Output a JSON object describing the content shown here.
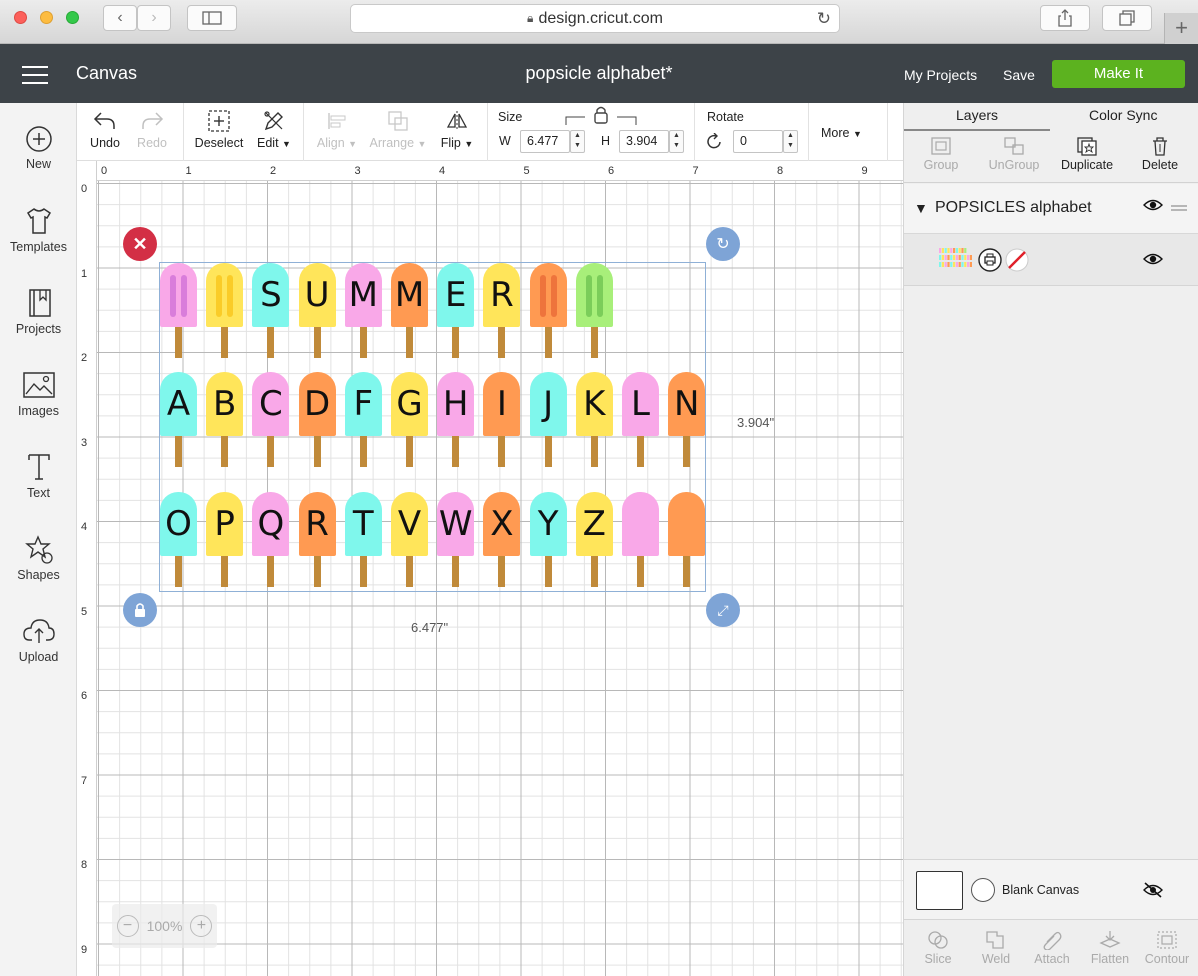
{
  "browser": {
    "url": "design.cricut.com"
  },
  "header": {
    "canvas_label": "Canvas",
    "doc_title": "popsicle alphabet*",
    "my_projects": "My Projects",
    "save": "Save",
    "make_it": "Make It",
    "accent_color": "#5cb21f"
  },
  "leftbar": {
    "items": [
      {
        "label": "New",
        "icon": "plus-circle-icon"
      },
      {
        "label": "Templates",
        "icon": "tshirt-icon"
      },
      {
        "label": "Projects",
        "icon": "book-icon"
      },
      {
        "label": "Images",
        "icon": "image-icon"
      },
      {
        "label": "Text",
        "icon": "text-icon"
      },
      {
        "label": "Shapes",
        "icon": "shapes-icon"
      },
      {
        "label": "Upload",
        "icon": "cloud-upload-icon"
      }
    ]
  },
  "toolbar": {
    "undo": "Undo",
    "redo": "Redo",
    "deselect": "Deselect",
    "edit": "Edit",
    "align": "Align",
    "arrange": "Arrange",
    "flip": "Flip",
    "size_label": "Size",
    "w_label": "W",
    "w_value": "6.477",
    "h_label": "H",
    "h_value": "3.904",
    "rotate_label": "Rotate",
    "rotate_value": "0",
    "more": "More"
  },
  "canvas": {
    "ruler_x": [
      "0",
      "1",
      "2",
      "3",
      "4",
      "5",
      "6",
      "7",
      "8",
      "9"
    ],
    "ruler_y": [
      "0",
      "1",
      "2",
      "3",
      "4",
      "5",
      "6",
      "7",
      "8",
      "9"
    ],
    "width_label": "6.477\"",
    "height_label": "3.904\"",
    "zoom": "100%",
    "popsicles": [
      [
        {
          "letter": "",
          "color": "#f9a8e8",
          "stripe": "#c05ad0"
        },
        {
          "letter": "",
          "color": "#ffe55a",
          "stripe": "#f5b800"
        },
        {
          "letter": "S",
          "color": "#7ff7ec"
        },
        {
          "letter": "U",
          "color": "#ffe55a"
        },
        {
          "letter": "M",
          "color": "#f9a8e8"
        },
        {
          "letter": "M",
          "color": "#ff9a52"
        },
        {
          "letter": "E",
          "color": "#7ff7ec"
        },
        {
          "letter": "R",
          "color": "#ffe55a"
        },
        {
          "letter": "",
          "color": "#ff9a52",
          "stripe": "#e0552a"
        },
        {
          "letter": "",
          "color": "#a8ef7a",
          "stripe": "#55b040"
        }
      ],
      [
        {
          "letter": "A",
          "color": "#7ff7ec"
        },
        {
          "letter": "B",
          "color": "#ffe55a"
        },
        {
          "letter": "C",
          "color": "#f9a8e8"
        },
        {
          "letter": "D",
          "color": "#ff9a52"
        },
        {
          "letter": "F",
          "color": "#7ff7ec"
        },
        {
          "letter": "G",
          "color": "#ffe55a"
        },
        {
          "letter": "H",
          "color": "#f9a8e8"
        },
        {
          "letter": "I",
          "color": "#ff9a52"
        },
        {
          "letter": "J",
          "color": "#7ff7ec"
        },
        {
          "letter": "K",
          "color": "#ffe55a"
        },
        {
          "letter": "L",
          "color": "#f9a8e8"
        },
        {
          "letter": "N",
          "color": "#ff9a52"
        }
      ],
      [
        {
          "letter": "O",
          "color": "#7ff7ec"
        },
        {
          "letter": "P",
          "color": "#ffe55a"
        },
        {
          "letter": "Q",
          "color": "#f9a8e8"
        },
        {
          "letter": "R",
          "color": "#ff9a52"
        },
        {
          "letter": "T",
          "color": "#7ff7ec"
        },
        {
          "letter": "V",
          "color": "#ffe55a"
        },
        {
          "letter": "W",
          "color": "#f9a8e8"
        },
        {
          "letter": "X",
          "color": "#ff9a52"
        },
        {
          "letter": "Y",
          "color": "#7ff7ec"
        },
        {
          "letter": "Z",
          "color": "#ffe55a"
        },
        {
          "letter": "",
          "color": "#f9a8e8"
        },
        {
          "letter": "",
          "color": "#ff9a52"
        }
      ]
    ]
  },
  "rightpanel": {
    "tabs": [
      "Layers",
      "Color Sync"
    ],
    "tools": [
      "Group",
      "UnGroup",
      "Duplicate",
      "Delete"
    ],
    "group_name": "POPSICLES alphabet",
    "blank_canvas": "Blank Canvas",
    "bottom_tools": [
      "Slice",
      "Weld",
      "Attach",
      "Flatten",
      "Contour"
    ]
  }
}
